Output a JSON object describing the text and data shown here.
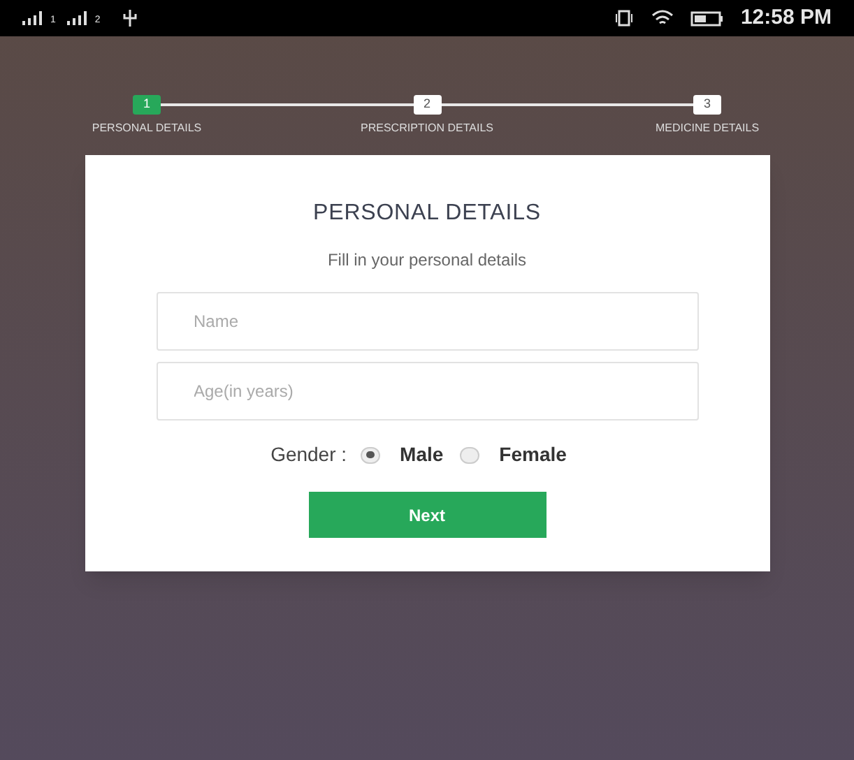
{
  "status_bar": {
    "sims": [
      "1",
      "2"
    ],
    "time": "12:58 PM"
  },
  "steps": [
    {
      "number": "1",
      "label": "PERSONAL DETAILS",
      "selected": true
    },
    {
      "number": "2",
      "label": "PRESCRIPTION DETAILS",
      "selected": false
    },
    {
      "number": "3",
      "label": "MEDICINE DETAILS",
      "selected": false
    }
  ],
  "form": {
    "title": "PERSONAL DETAILS",
    "subtitle": "Fill in your personal details",
    "fields": [
      {
        "placeholder": "Name"
      },
      {
        "placeholder": "Age(in years)"
      }
    ],
    "gender": {
      "label": "Gender :",
      "options": [
        {
          "label": "Male",
          "selected": true
        },
        {
          "label": "Female",
          "selected": false
        }
      ]
    },
    "button": "Next"
  }
}
